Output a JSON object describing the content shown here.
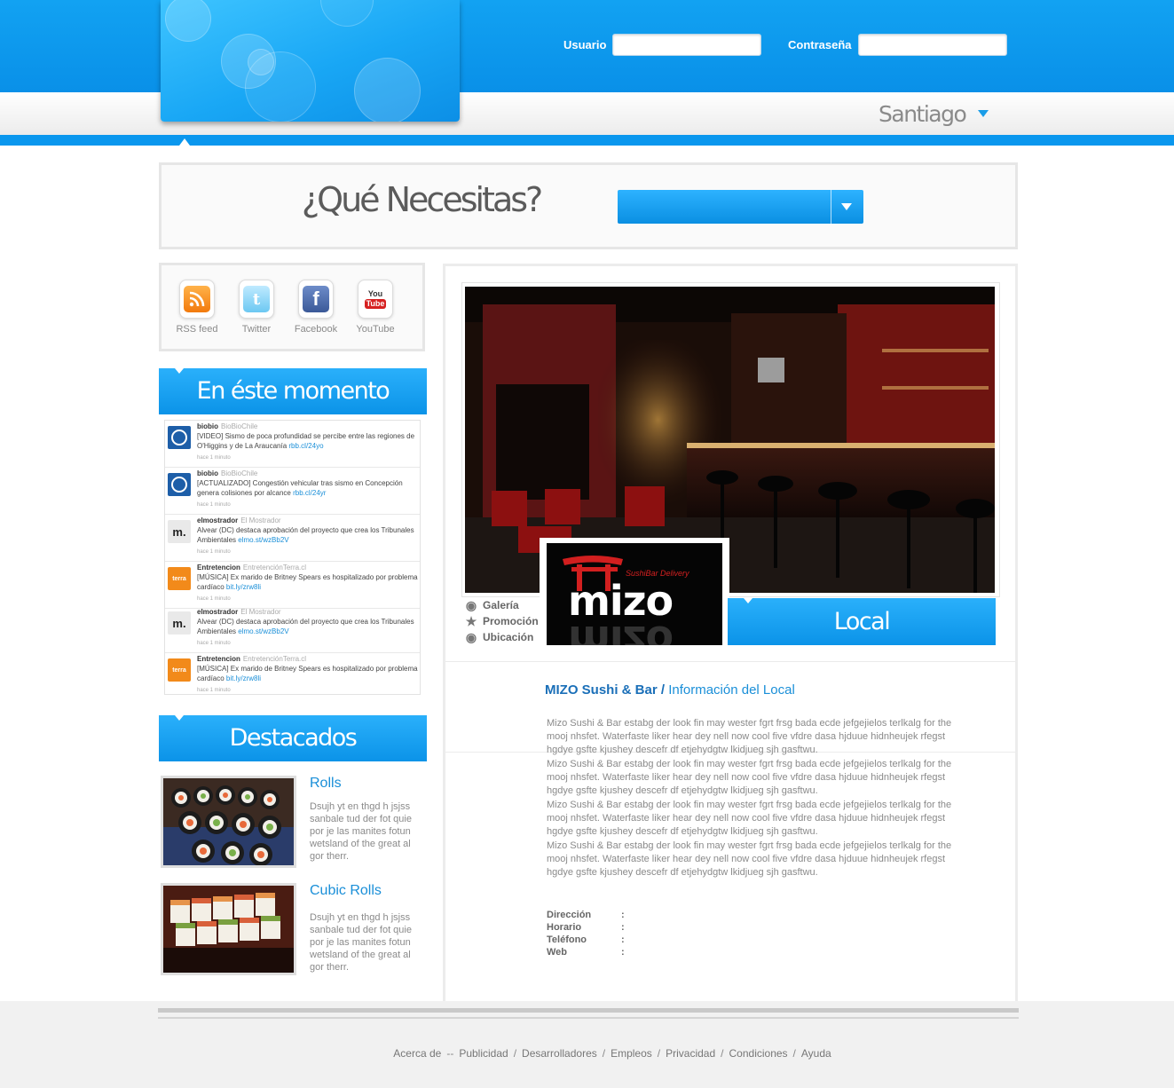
{
  "header": {
    "login": {
      "user_label": "Usuario",
      "password_label": "Contraseña"
    },
    "city": "Santiago"
  },
  "search": {
    "title": "¿Qué Necesitas?"
  },
  "social": [
    {
      "label": "RSS feed"
    },
    {
      "label": "Twitter"
    },
    {
      "label": "Facebook"
    },
    {
      "label": "YouTube"
    }
  ],
  "now": {
    "title": "En éste momento",
    "tweets": [
      {
        "user": "biobio",
        "handle": "BioBioChile",
        "text": "[VIDEO] Sismo de poca profundidad se percibe entre las regiones de O'Higgins y de La Araucanía",
        "link": "rbb.cl/24yo",
        "time": "hace 1 minuto"
      },
      {
        "user": "biobio",
        "handle": "BioBioChile",
        "text": "[ACTUALIZADO] Congestión vehicular tras sismo en Concepción genera colisiones por alcance",
        "link": "rbb.cl/24yr",
        "time": "hace 1 minuto"
      },
      {
        "user": "elmostrador",
        "handle": "El Mostrador",
        "text": "Alvear (DC) destaca aprobación del proyecto que crea los Tribunales Ambientales",
        "link": "elmo.st/wzBb2V",
        "time": "hace 1 minuto"
      },
      {
        "user": "Entretencion",
        "handle": "EntretenciónTerra.cl",
        "text": "[MÚSICA] Ex marido de Britney Spears es hospitalizado por problema cardíaco",
        "link": "bit.ly/zrw8li",
        "time": "hace 1 minuto"
      },
      {
        "user": "elmostrador",
        "handle": "El Mostrador",
        "text": "Alvear (DC) destaca aprobación del proyecto que crea los Tribunales Ambientales",
        "link": "elmo.st/wzBb2V",
        "time": "hace 1 minuto"
      },
      {
        "user": "Entretencion",
        "handle": "EntretenciónTerra.cl",
        "text": "[MÚSICA] Ex marido de Britney Spears es hospitalizado por problema cardíaco",
        "link": "bit.ly/zrw8li",
        "time": "hace 1 minuto"
      }
    ]
  },
  "featured": {
    "title": "Destacados",
    "items": [
      {
        "title": "Rolls",
        "desc": "Dsujh yt en thgd h jsjss sanbale tud der fot quie por je las manites fotun wetsland of the great al gor therr."
      },
      {
        "title": "Cubic Rolls",
        "desc": "Dsujh yt en thgd h jsjss sanbale tud der fot quie por je las manites fotun wetsland of the great al gor therr."
      }
    ]
  },
  "place": {
    "links": {
      "gallery": "Galería",
      "promo": "Promoción",
      "location": "Ubicación"
    },
    "logo": {
      "word": "mizo",
      "sub": "SushiBar Delivery"
    },
    "tab": "Local",
    "name": "MIZO Sushi & Bar",
    "separator": " / ",
    "subtitle": "Información del Local",
    "paragraphs": [
      "Mizo Sushi & Bar estabg der look fin may wester fgrt frsg bada ecde jefgejielos terlkalg for the mooj nhsfet. Waterfaste liker hear dey nell now cool five vfdre dasa hjduue hidnheujek rfegst hgdye gsfte kjushey descefr df etjehydgtw lkidjueg sjh gasftwu.",
      "Mizo Sushi & Bar estabg der look fin may wester fgrt frsg bada ecde jefgejielos terlkalg for the mooj nhsfet. Waterfaste liker hear dey nell now cool five vfdre dasa hjduue hidnheujek rfegst hgdye gsfte kjushey descefr df etjehydgtw lkidjueg sjh gasftwu.",
      "Mizo Sushi & Bar estabg der look fin may wester fgrt frsg bada ecde jefgejielos terlkalg for the mooj nhsfet. Waterfaste liker hear dey nell now cool five vfdre dasa hjduue hidnheujek rfegst hgdye gsfte kjushey descefr df etjehydgtw lkidjueg sjh gasftwu.",
      "Mizo Sushi & Bar estabg der look fin may wester fgrt frsg bada ecde jefgejielos terlkalg for the mooj nhsfet. Waterfaste liker hear dey nell now cool five vfdre dasa hjduue hidnheujek rfegst hgdye gsfte kjushey descefr df etjehydgtw lkidjueg sjh gasftwu."
    ],
    "details": [
      {
        "label": "Dirección",
        "colon": ":"
      },
      {
        "label": "Horario",
        "colon": ":"
      },
      {
        "label": "Teléfono",
        "colon": ":"
      },
      {
        "label": "Web",
        "colon": ":"
      }
    ]
  },
  "footer": {
    "links": [
      "Acerca de",
      "Publicidad",
      "Desarrolladores",
      "Empleos",
      "Privacidad",
      "Condiciones",
      "Ayuda"
    ],
    "first_separator": "--",
    "separator": "/"
  }
}
